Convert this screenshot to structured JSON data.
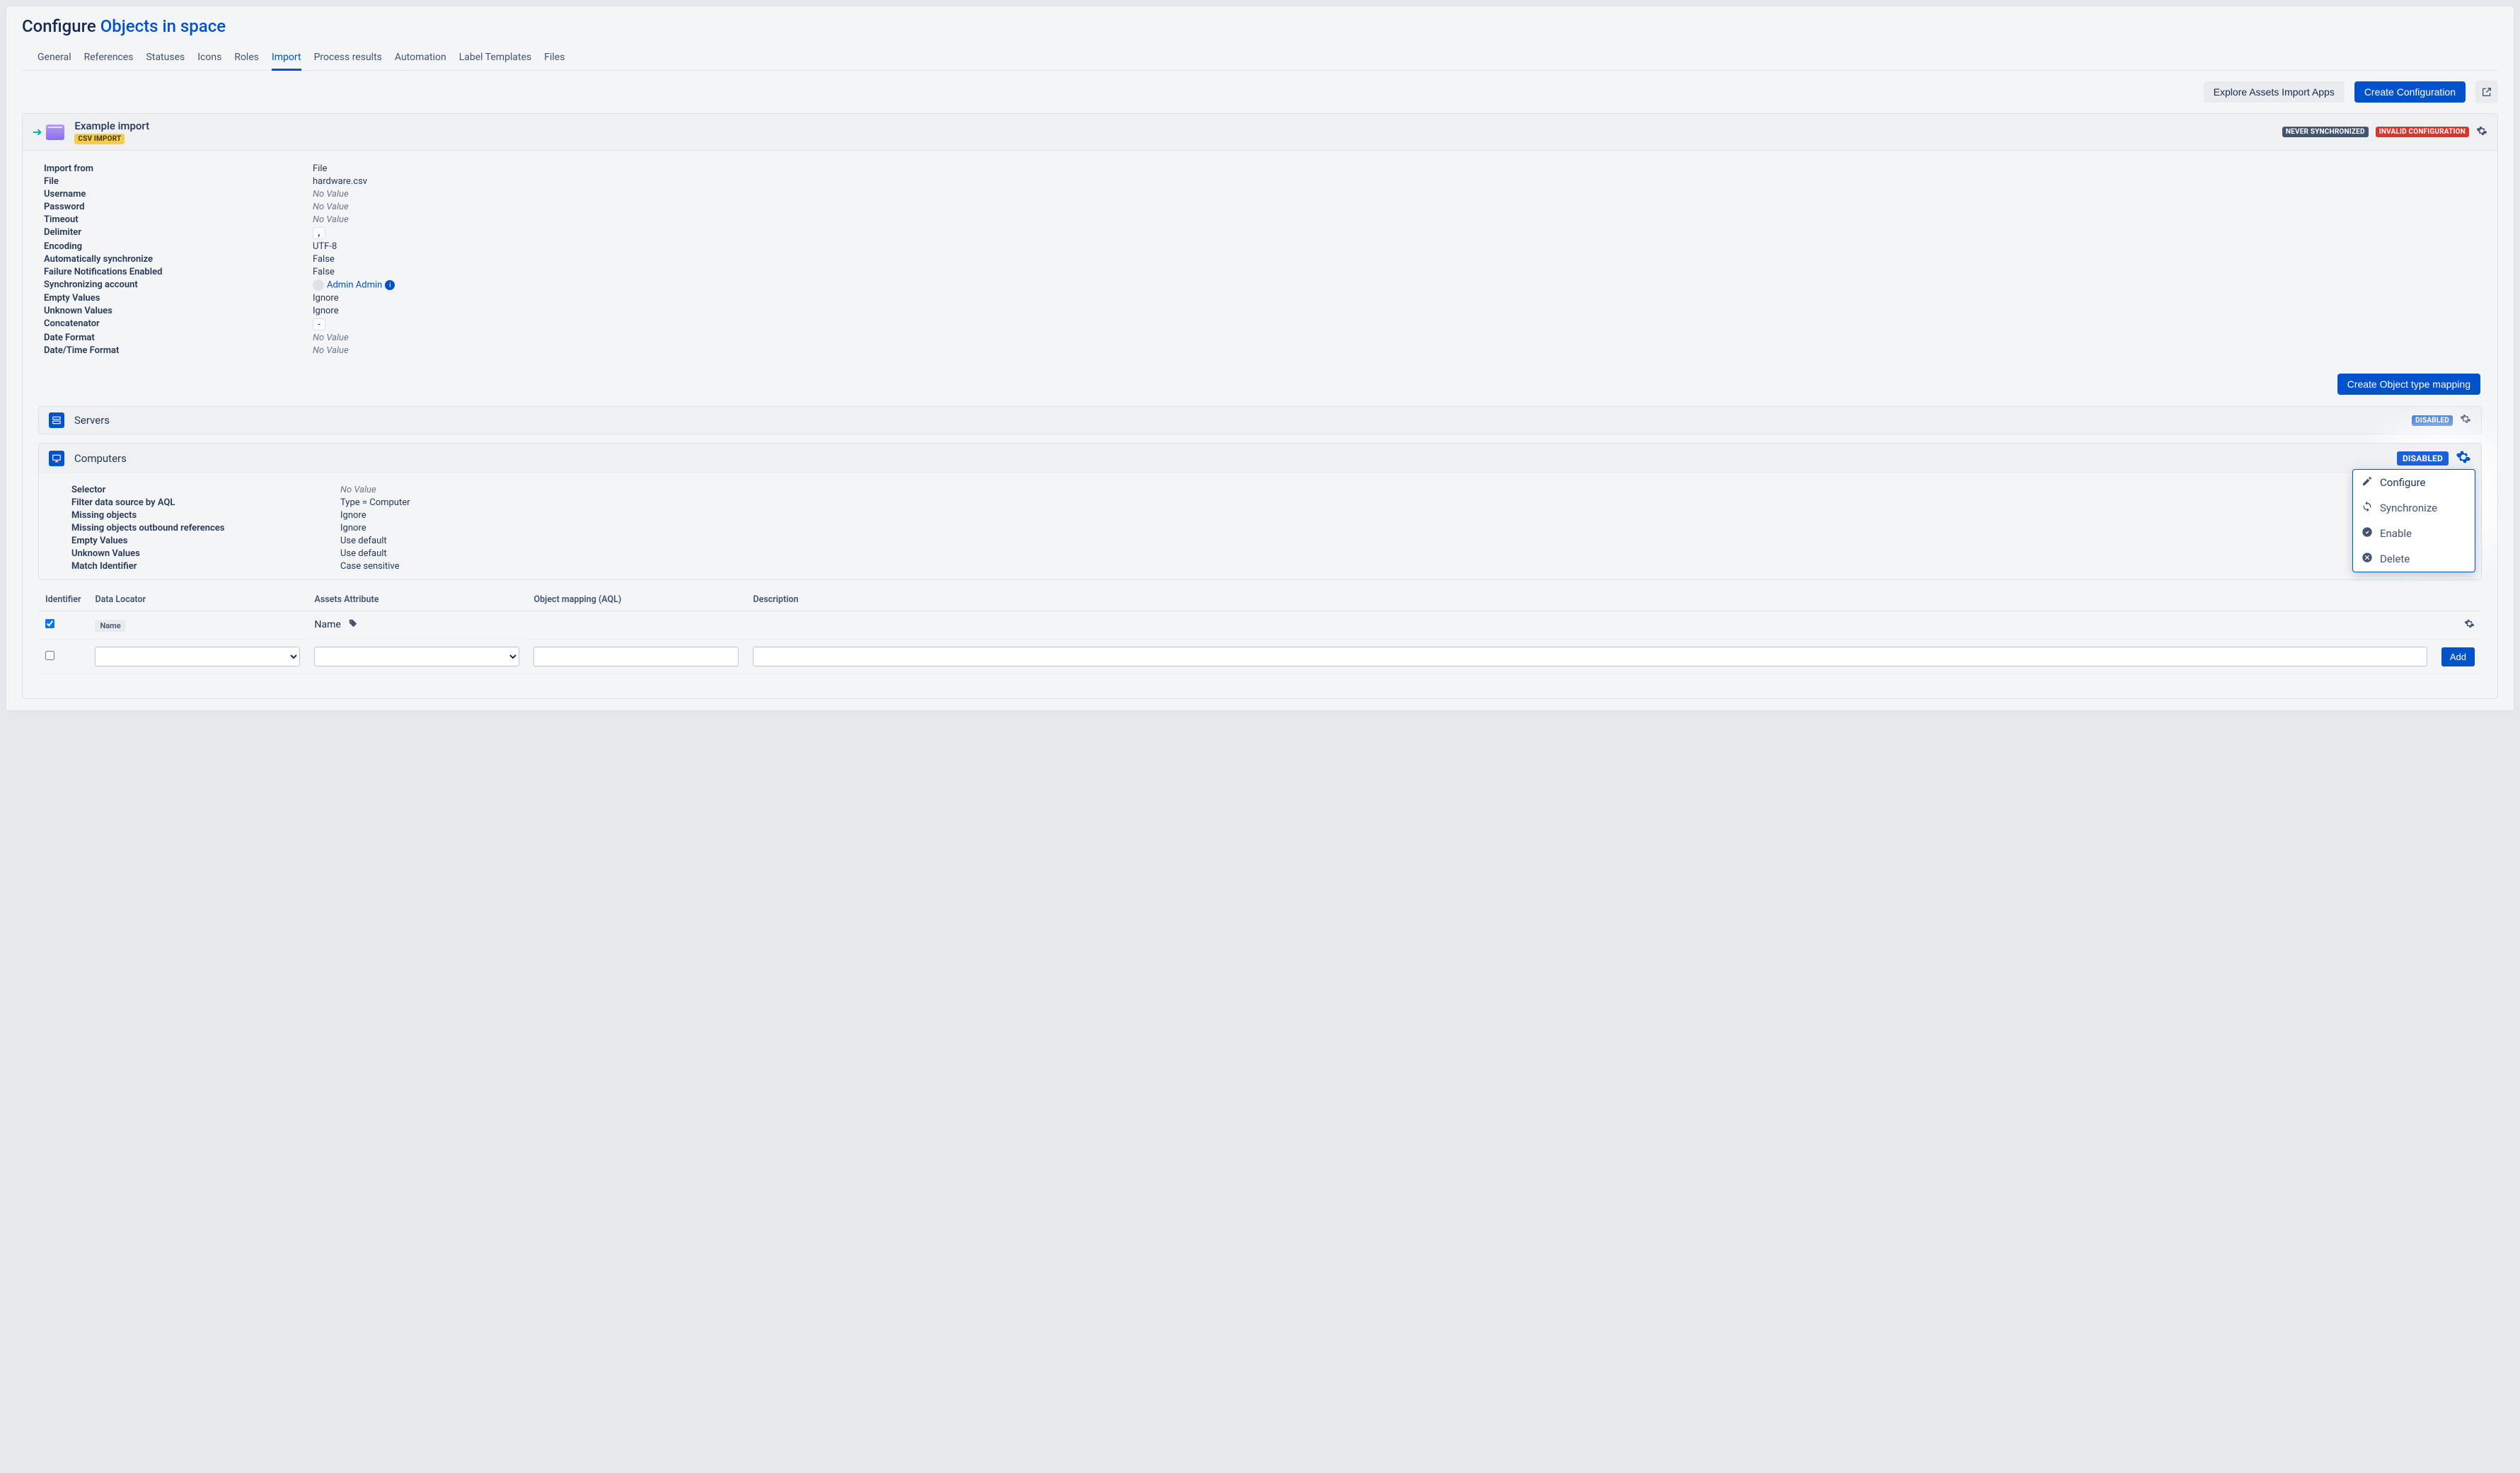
{
  "page": {
    "title_prefix": "Configure",
    "title_name": "Objects in space"
  },
  "tabs": [
    {
      "label": "General"
    },
    {
      "label": "References"
    },
    {
      "label": "Statuses"
    },
    {
      "label": "Icons"
    },
    {
      "label": "Roles"
    },
    {
      "label": "Import",
      "active": true
    },
    {
      "label": "Process results"
    },
    {
      "label": "Automation"
    },
    {
      "label": "Label Templates"
    },
    {
      "label": "Files"
    }
  ],
  "toolbar": {
    "explore_label": "Explore Assets Import Apps",
    "create_config_label": "Create Configuration"
  },
  "import_panel": {
    "title": "Example import",
    "type_lozenge": "CSV IMPORT",
    "status_never_sync": "NEVER SYNCHRONIZED",
    "status_invalid": "INVALID CONFIGURATION",
    "fields": [
      {
        "k": "Import from",
        "v": "File"
      },
      {
        "k": "File",
        "v": "hardware.csv"
      },
      {
        "k": "Username",
        "v": "No Value",
        "novalue": true
      },
      {
        "k": "Password",
        "v": "No Value",
        "novalue": true
      },
      {
        "k": "Timeout",
        "v": "No Value",
        "novalue": true
      },
      {
        "k": "Delimiter",
        "v": ",",
        "codebox": true
      },
      {
        "k": "Encoding",
        "v": "UTF-8"
      },
      {
        "k": "Automatically synchronize",
        "v": "False"
      },
      {
        "k": "Failure Notifications Enabled",
        "v": "False"
      },
      {
        "k": "Synchronizing account",
        "v": "Admin Admin",
        "user": true
      },
      {
        "k": "Empty Values",
        "v": "Ignore"
      },
      {
        "k": "Unknown Values",
        "v": "Ignore"
      },
      {
        "k": "Concatenator",
        "v": "-",
        "codebox": true
      },
      {
        "k": "Date Format",
        "v": "No Value",
        "novalue": true
      },
      {
        "k": "Date/Time Format",
        "v": "No Value",
        "novalue": true
      }
    ],
    "create_mapping_label": "Create Object type mapping"
  },
  "servers_section": {
    "name": "Servers",
    "disabled_label": "DISABLED"
  },
  "computers_section": {
    "name": "Computers",
    "disabled_label": "DISABLED",
    "fields": [
      {
        "k": "Selector",
        "v": "No Value",
        "novalue": true
      },
      {
        "k": "Filter data source by AQL",
        "v": "Type = Computer"
      },
      {
        "k": "Missing objects",
        "v": "Ignore"
      },
      {
        "k": "Missing objects outbound references",
        "v": "Ignore"
      },
      {
        "k": "Empty Values",
        "v": "Use default"
      },
      {
        "k": "Unknown Values",
        "v": "Use default"
      },
      {
        "k": "Match Identifier",
        "v": "Case sensitive"
      }
    ]
  },
  "popover": {
    "items": [
      {
        "icon": "edit",
        "label": "Configure"
      },
      {
        "icon": "sync",
        "label": "Synchronize"
      },
      {
        "icon": "check",
        "label": "Enable"
      },
      {
        "icon": "delete",
        "label": "Delete"
      }
    ]
  },
  "table": {
    "headers": {
      "identifier": "Identifier",
      "data_locator": "Data Locator",
      "assets_attribute": "Assets Attribute",
      "object_mapping": "Object mapping (AQL)",
      "description": "Description"
    },
    "row1": {
      "name_chip": "Name",
      "attribute": "Name"
    },
    "add_label": "Add"
  }
}
